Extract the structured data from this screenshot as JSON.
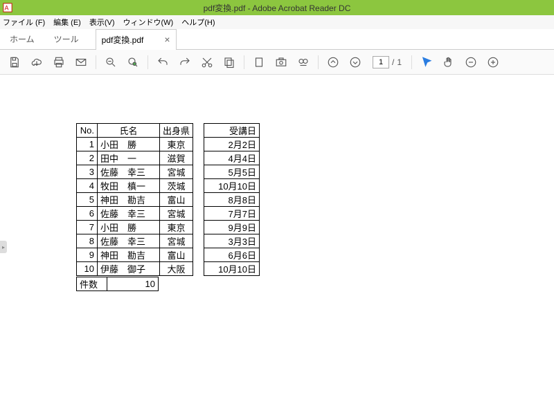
{
  "window": {
    "title": "pdf変換.pdf - Adobe Acrobat Reader DC"
  },
  "menu": {
    "file": "ファイル (F)",
    "edit": "編集 (E)",
    "view": "表示(V)",
    "window": "ウィンドウ(W)",
    "help": "ヘルプ(H)"
  },
  "tabs": {
    "home": "ホーム",
    "tools": "ツール",
    "doc": "pdf変換.pdf",
    "close": "×"
  },
  "toolbar": {
    "page_current": "1",
    "page_sep": "/",
    "page_total": "1"
  },
  "table": {
    "headers": {
      "no": "No.",
      "name": "氏名",
      "pref": "出身県",
      "date": "受講日"
    },
    "rows": [
      {
        "no": "1",
        "name": "小田　勝",
        "pref": "東京",
        "date": "2月2日"
      },
      {
        "no": "2",
        "name": "田中　一",
        "pref": "滋賀",
        "date": "4月4日"
      },
      {
        "no": "3",
        "name": "佐藤　幸三",
        "pref": "宮城",
        "date": "5月5日"
      },
      {
        "no": "4",
        "name": "牧田　槙一",
        "pref": "茨城",
        "date": "10月10日"
      },
      {
        "no": "5",
        "name": "神田　勘吉",
        "pref": "富山",
        "date": "8月8日"
      },
      {
        "no": "6",
        "name": "佐藤　幸三",
        "pref": "宮城",
        "date": "7月7日"
      },
      {
        "no": "7",
        "name": "小田　勝",
        "pref": "東京",
        "date": "9月9日"
      },
      {
        "no": "8",
        "name": "佐藤　幸三",
        "pref": "宮城",
        "date": "3月3日"
      },
      {
        "no": "9",
        "name": "神田　勘吉",
        "pref": "富山",
        "date": "6月6日"
      },
      {
        "no": "10",
        "name": "伊藤　御子",
        "pref": "大阪",
        "date": "10月10日"
      }
    ]
  },
  "count": {
    "label": "件数",
    "value": "10"
  }
}
